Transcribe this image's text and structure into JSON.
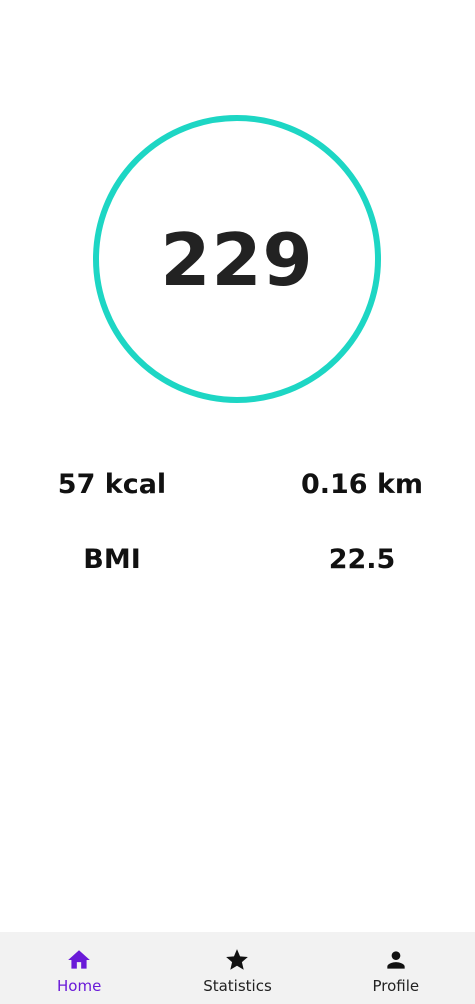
{
  "steps": {
    "count": "229"
  },
  "stats": {
    "calories": "57 kcal",
    "distance": "0.16 km",
    "bmi_label": "BMI",
    "bmi_value": "22.5"
  },
  "bottom_nav": {
    "active": "home",
    "items": [
      {
        "label": "Home",
        "icon": "home-icon"
      },
      {
        "label": "Statistics",
        "icon": "star-icon"
      },
      {
        "label": "Profile",
        "icon": "person-icon"
      }
    ]
  },
  "colors": {
    "ring": "#1dd6c4",
    "active_nav": "#6a1ad8",
    "nav_background": "#f2f2f2"
  }
}
